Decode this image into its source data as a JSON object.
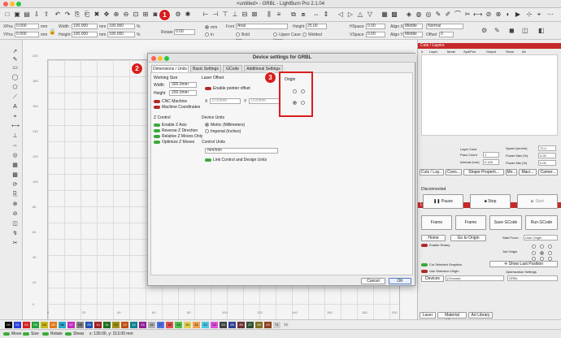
{
  "window": {
    "title": "<untitled> - GRBL - LightBurn Pro 2.1.04"
  },
  "propbar": {
    "xpos_label": "XPos",
    "xpos_value": "0.000",
    "ypos_label": "YPos",
    "ypos_value": "0.000",
    "width_label": "Width",
    "width_value": "100.000",
    "height_label": "Height",
    "height_value": "100.000",
    "unit_mm": "mm",
    "unit_pct": "%",
    "pct_value": "100.000",
    "rotate_label": "Rotate",
    "rotate_value": "0.00",
    "mm_radio": "mm",
    "in_radio": "in",
    "font_label": "Font",
    "font_value": "Arial",
    "height2_label": "Height",
    "height2_value": "25.00",
    "hspace_label": "HSpace",
    "hspace_value": "0.00",
    "vspace_label": "VSpace",
    "vspace_value": "0.00",
    "bold": "Bold",
    "italic": "Italic",
    "upper": "Upper Case",
    "welded": "Welded",
    "distort": "Distort",
    "alignx_label": "Align X",
    "alignx_value": "Middle",
    "aligny_label": "Align Y",
    "aligny_value": "Middle",
    "normal_value": "Normal",
    "offset_label": "Offset",
    "offset_value": "0"
  },
  "canvas": {
    "y_ticks": [
      "200",
      "180",
      "160",
      "140",
      "120",
      "100",
      "80",
      "60",
      "40",
      "20",
      "0"
    ],
    "x_ticks": [
      "0",
      "20",
      "40",
      "60",
      "80",
      "100",
      "120",
      "140",
      "160",
      "180",
      "200"
    ]
  },
  "dialog": {
    "title": "Device settings for GRBL",
    "tabs": [
      "Dimensions / Units",
      "Basic Settings",
      "GCode",
      "Additional Settings"
    ],
    "working_size": {
      "heading": "Working Size",
      "width_label": "Width",
      "width_value": "300.0mm",
      "height_label": "Height",
      "height_value": "200.0mm",
      "cnc_machine": "CNC Machine",
      "machine_coords": "Machine Coordinates"
    },
    "laser_offset": {
      "heading": "Laser Offset",
      "enable_pointer": "Enable pointer offset",
      "x_label": "X",
      "x_value": "0.00mm",
      "y_label": "Y",
      "y_value": "0.00mm"
    },
    "origin": {
      "heading": "Origin"
    },
    "z_control": {
      "heading": "Z Control",
      "enable_z": "Enable Z Axis",
      "reverse_z": "Reverse Z Direction",
      "relative_z": "Relative Z Moves Only",
      "optimize_z": "Optimize Z Moves"
    },
    "device_units": {
      "heading": "Device Units",
      "metric": "Metric (Millimeters)",
      "imperial": "Imperial (Inches)"
    },
    "control_units": {
      "heading": "Control Units",
      "value": "mm/min",
      "link": "Link Control and Design Units"
    },
    "cancel": "Cancel",
    "ok": "OK"
  },
  "callouts": [
    "1",
    "2",
    "3"
  ],
  "cuts_panel": {
    "header": "Cuts / Layers",
    "columns": [
      "#",
      "Layer",
      "Mode",
      "Spd/Pwr",
      "Output",
      "Show",
      "Air"
    ],
    "layer_color": "Layer Color",
    "pass_count": "Pass Count",
    "pass_value": "1",
    "interval": "Interval (mm)",
    "interval_value": "0.100",
    "speed": "Speed (mm/m)",
    "speed_value": "72.0",
    "power_max": "Power Max (%)",
    "power_max_value": "0.00",
    "power_min": "Power Min (%)",
    "power_min_value": "0.00",
    "tabs": [
      "Cuts / Lay...",
      "Cons...",
      "Shape Properti...",
      "Mo...",
      "Macr...",
      "Camer..."
    ]
  },
  "laser_panel": {
    "header": "Laser",
    "status": "Disconnected",
    "pause": "Pause",
    "stop": "Stop",
    "start": "Start",
    "frame1": "Frame",
    "frame2": "Frame",
    "save_gcode": "Save GCode",
    "run_gcode": "Run GCode",
    "home": "Home",
    "go_to_origin": "Go to Origin",
    "start_from_label": "Start From:",
    "start_from_value": "User Origin",
    "enable_rotary": "Enable Rotary",
    "job_origin": "Job Origin",
    "cut_selected": "Cut Selected Graphics",
    "use_selection_origin": "Use Selection Origin",
    "show_last_position": "Show Last Position",
    "optimization_settings": "Optimization Settings",
    "devices": "Devices",
    "devices_value": "(Choose)",
    "device_name": "GRBL",
    "tabs": [
      "Laser",
      "Material Library",
      "Art Library"
    ]
  },
  "swatches": [
    "00",
    "01",
    "02",
    "03",
    "04",
    "05",
    "06",
    "07",
    "08",
    "09",
    "10",
    "11",
    "12",
    "13",
    "14",
    "15",
    "16",
    "17",
    "18",
    "19",
    "20",
    "21",
    "22",
    "23",
    "24",
    "25",
    "26",
    "27",
    "28",
    "29",
    "T1",
    "T2"
  ],
  "swatch_colors": [
    "#000000",
    "#2a3fd8",
    "#d81e1e",
    "#23a23a",
    "#c9b61a",
    "#e07a18",
    "#2aa8c9",
    "#c42ac0",
    "#808080",
    "#2050b0",
    "#a02020",
    "#207020",
    "#a09018",
    "#c05010",
    "#108090",
    "#902090",
    "#b0b0b0",
    "#5070e0",
    "#e05050",
    "#50c050",
    "#e0d050",
    "#f0a050",
    "#50c8e0",
    "#e050e0",
    "#404040",
    "#304090",
    "#703030",
    "#305030",
    "#807020",
    "#904020",
    "#d0d0d0",
    "#e8e8e8"
  ],
  "statusbar": {
    "move": "Move",
    "size": "Size",
    "rotate": "Rotate",
    "shear": "Shear",
    "coords": "x: 139.00, y: 213.00 mm"
  }
}
